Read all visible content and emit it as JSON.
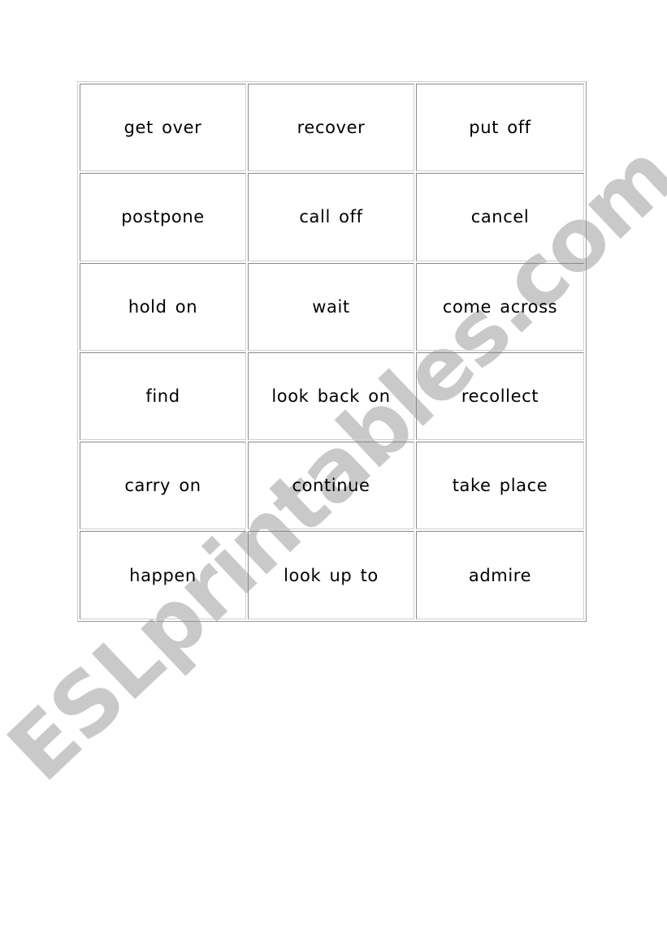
{
  "document": {
    "watermark": "ESLprintables.com",
    "colors": {
      "watermark": "#c9c9c9",
      "text": "#000000",
      "cell_border": "#8a8a8a"
    },
    "cards": [
      [
        "get over",
        "recover",
        "put off"
      ],
      [
        "postpone",
        "call off",
        "cancel"
      ],
      [
        "hold on",
        "wait",
        "come across"
      ],
      [
        "find",
        "look back on",
        "recollect"
      ],
      [
        "carry on",
        "continue",
        "take place"
      ],
      [
        "happen",
        "look up to",
        "admire"
      ]
    ]
  }
}
